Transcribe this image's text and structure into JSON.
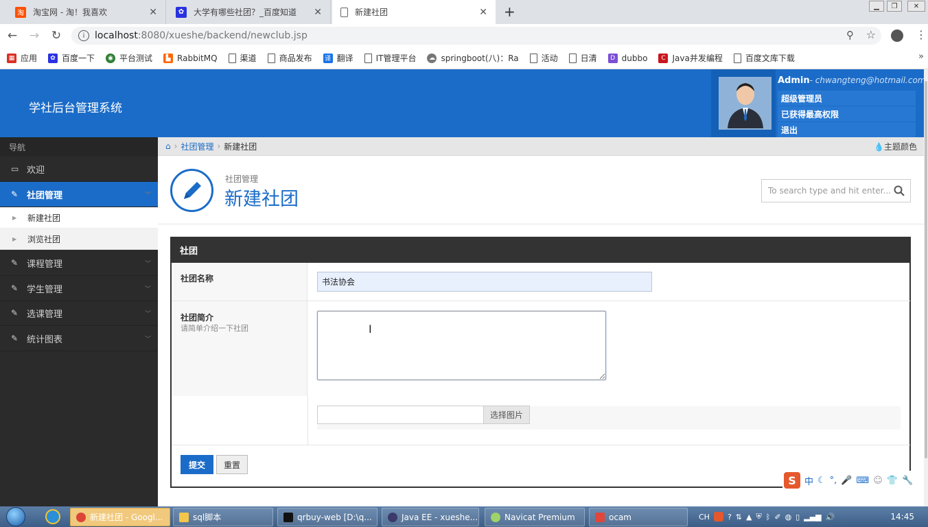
{
  "browser": {
    "tabs": [
      {
        "title": "淘宝网 - 淘！我喜欢",
        "favicon": "taobao-icon",
        "color": "#ff5000"
      },
      {
        "title": "大学有哪些社团？_百度知道",
        "favicon": "baidu-paw-icon",
        "color": "#2932e1"
      },
      {
        "title": "新建社团",
        "favicon": "document-icon",
        "color": "#666666"
      }
    ],
    "new_tab": "+",
    "url_host": "localhost",
    "url_path": ":8080/xueshe/backend/newclub.jsp",
    "bookmarks": [
      {
        "label": "应用",
        "icon": "apps-grid-icon",
        "color": "#d93025"
      },
      {
        "label": "百度一下",
        "icon": "baidu-paw-icon",
        "color": "#2932e1"
      },
      {
        "label": "平台测试",
        "icon": "globe-icon",
        "color": "#2e7d32"
      },
      {
        "label": "RabbitMQ",
        "icon": "rabbitmq-icon",
        "color": "#ff6600"
      },
      {
        "label": "渠道",
        "icon": "document-icon",
        "color": ""
      },
      {
        "label": "商品发布",
        "icon": "document-icon",
        "color": ""
      },
      {
        "label": "翻译",
        "icon": "translate-icon",
        "color": "#1a73e8"
      },
      {
        "label": "IT管理平台",
        "icon": "document-icon",
        "color": ""
      },
      {
        "label": "springboot(八)：Ra",
        "icon": "cloud-icon",
        "color": "#777777"
      },
      {
        "label": "活动",
        "icon": "document-icon",
        "color": ""
      },
      {
        "label": "日清",
        "icon": "document-icon",
        "color": ""
      },
      {
        "label": "dubbo",
        "icon": "dubbo-icon",
        "color": "#7b4fd6"
      },
      {
        "label": "Java并发编程",
        "icon": "csdn-icon",
        "color": "#c9171e"
      },
      {
        "label": "百度文库下载",
        "icon": "document-icon",
        "color": ""
      }
    ]
  },
  "app": {
    "brand": "学社后台管理系统",
    "accent": "#1b6cc8",
    "user": {
      "name": "Admin",
      "email": "- chwangteng@hotmail.com",
      "menu": [
        "超级管理员",
        "已获得最高权限",
        "退出"
      ]
    },
    "sidebar": {
      "heading": "导航",
      "items": [
        {
          "label": "欢迎",
          "icon": "monitor-icon"
        },
        {
          "label": "社团管理",
          "icon": "pencil-icon",
          "active": true
        },
        {
          "label": "课程管理",
          "icon": "pencil-icon"
        },
        {
          "label": "学生管理",
          "icon": "pencil-icon"
        },
        {
          "label": "选课管理",
          "icon": "pencil-icon"
        },
        {
          "label": "统计图表",
          "icon": "pencil-icon"
        }
      ],
      "subitems": [
        "新建社团",
        "浏览社团"
      ]
    },
    "breadcrumb": {
      "home_icon": "home-icon",
      "parent": "社团管理",
      "current": "新建社团",
      "theme": "主题颜色"
    },
    "page": {
      "subtitle": "社团管理",
      "title": "新建社团",
      "search_placeholder": "To search type and hit enter..."
    },
    "form": {
      "panel_title": "社团",
      "name_label": "社团名称",
      "name_value": "书法协会",
      "intro_label": "社团简介",
      "intro_hint": "请简单介绍一下社团",
      "file_button": "选择图片",
      "submit": "提交",
      "reset": "重置"
    }
  },
  "ime": {
    "icons": [
      "sogou-s-icon",
      "中",
      "moon-icon",
      "punctuation-icon",
      "microphone-icon",
      "keyboard-icon",
      "user-icon",
      "shirt-icon",
      "wrench-icon"
    ],
    "lang_char": "中"
  },
  "taskbar": {
    "items": [
      {
        "label": "新建社团 - Googl...",
        "active": true,
        "icon": "chrome-icon"
      },
      {
        "label": "sql脚本",
        "icon": "folder-icon"
      },
      {
        "label": "qrbuy-web [D:\\q...",
        "icon": "intellij-icon"
      },
      {
        "label": "Java EE - xueshe...",
        "icon": "eclipse-icon"
      },
      {
        "label": "Navicat Premium",
        "icon": "navicat-icon"
      },
      {
        "label": "ocam",
        "icon": "ocam-icon"
      }
    ],
    "tray_lang": "CH",
    "clock": "14:45"
  }
}
